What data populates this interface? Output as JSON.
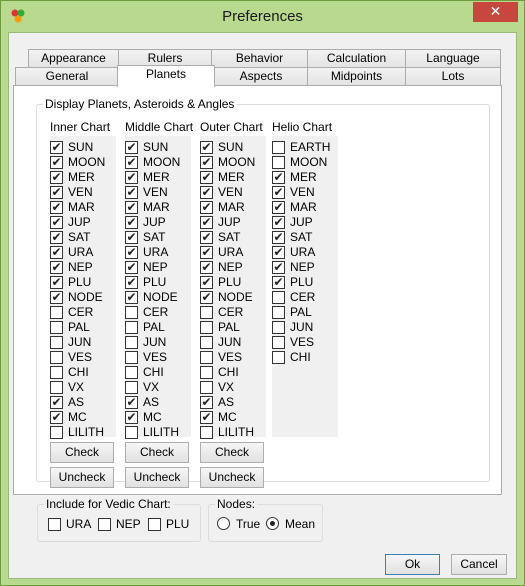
{
  "window": {
    "title": "Preferences",
    "close": "✕"
  },
  "tabs_row1": [
    "Appearance",
    "Rulers",
    "Behavior",
    "Calculation",
    "Language"
  ],
  "tabs_row2": [
    "General",
    "Planets",
    "Aspects",
    "Midpoints",
    "Lots"
  ],
  "active_tab": "Planets",
  "display_group_label": "Display Planets, Asteroids & Angles",
  "columns": [
    {
      "header": "Inner Chart",
      "items": [
        {
          "label": "SUN",
          "checked": true
        },
        {
          "label": "MOON",
          "checked": true
        },
        {
          "label": "MER",
          "checked": true
        },
        {
          "label": "VEN",
          "checked": true
        },
        {
          "label": "MAR",
          "checked": true
        },
        {
          "label": "JUP",
          "checked": true
        },
        {
          "label": "SAT",
          "checked": true
        },
        {
          "label": "URA",
          "checked": true
        },
        {
          "label": "NEP",
          "checked": true
        },
        {
          "label": "PLU",
          "checked": true
        },
        {
          "label": "NODE",
          "checked": true
        },
        {
          "label": "CER",
          "checked": false
        },
        {
          "label": "PAL",
          "checked": false
        },
        {
          "label": "JUN",
          "checked": false
        },
        {
          "label": "VES",
          "checked": false
        },
        {
          "label": "CHI",
          "checked": false
        },
        {
          "label": "VX",
          "checked": false
        },
        {
          "label": "AS",
          "checked": true
        },
        {
          "label": "MC",
          "checked": true
        },
        {
          "label": "LILITH",
          "checked": false
        }
      ]
    },
    {
      "header": "Middle Chart",
      "items": [
        {
          "label": "SUN",
          "checked": true
        },
        {
          "label": "MOON",
          "checked": true
        },
        {
          "label": "MER",
          "checked": true
        },
        {
          "label": "VEN",
          "checked": true
        },
        {
          "label": "MAR",
          "checked": true
        },
        {
          "label": "JUP",
          "checked": true
        },
        {
          "label": "SAT",
          "checked": true
        },
        {
          "label": "URA",
          "checked": true
        },
        {
          "label": "NEP",
          "checked": true
        },
        {
          "label": "PLU",
          "checked": true
        },
        {
          "label": "NODE",
          "checked": true
        },
        {
          "label": "CER",
          "checked": false
        },
        {
          "label": "PAL",
          "checked": false
        },
        {
          "label": "JUN",
          "checked": false
        },
        {
          "label": "VES",
          "checked": false
        },
        {
          "label": "CHI",
          "checked": false
        },
        {
          "label": "VX",
          "checked": false
        },
        {
          "label": "AS",
          "checked": true
        },
        {
          "label": "MC",
          "checked": true
        },
        {
          "label": "LILITH",
          "checked": false
        }
      ]
    },
    {
      "header": "Outer Chart",
      "items": [
        {
          "label": "SUN",
          "checked": true
        },
        {
          "label": "MOON",
          "checked": true
        },
        {
          "label": "MER",
          "checked": true
        },
        {
          "label": "VEN",
          "checked": true
        },
        {
          "label": "MAR",
          "checked": true
        },
        {
          "label": "JUP",
          "checked": true
        },
        {
          "label": "SAT",
          "checked": true
        },
        {
          "label": "URA",
          "checked": true
        },
        {
          "label": "NEP",
          "checked": true
        },
        {
          "label": "PLU",
          "checked": true
        },
        {
          "label": "NODE",
          "checked": true
        },
        {
          "label": "CER",
          "checked": false
        },
        {
          "label": "PAL",
          "checked": false
        },
        {
          "label": "JUN",
          "checked": false
        },
        {
          "label": "VES",
          "checked": false
        },
        {
          "label": "CHI",
          "checked": false
        },
        {
          "label": "VX",
          "checked": false
        },
        {
          "label": "AS",
          "checked": true
        },
        {
          "label": "MC",
          "checked": true
        },
        {
          "label": "LILITH",
          "checked": false
        }
      ]
    },
    {
      "header": "Helio Chart",
      "items": [
        {
          "label": "EARTH",
          "checked": false
        },
        {
          "label": "MOON",
          "checked": false
        },
        {
          "label": "MER",
          "checked": true
        },
        {
          "label": "VEN",
          "checked": true
        },
        {
          "label": "MAR",
          "checked": true
        },
        {
          "label": "JUP",
          "checked": true
        },
        {
          "label": "SAT",
          "checked": true
        },
        {
          "label": "URA",
          "checked": true
        },
        {
          "label": "NEP",
          "checked": true
        },
        {
          "label": "PLU",
          "checked": true
        },
        {
          "label": "CER",
          "checked": false
        },
        {
          "label": "PAL",
          "checked": false
        },
        {
          "label": "JUN",
          "checked": false
        },
        {
          "label": "VES",
          "checked": false
        },
        {
          "label": "CHI",
          "checked": false
        }
      ]
    }
  ],
  "check_label": "Check",
  "uncheck_label": "Uncheck",
  "vedic": {
    "label": "Include for Vedic Chart:",
    "items": [
      {
        "label": "URA",
        "checked": false
      },
      {
        "label": "NEP",
        "checked": false
      },
      {
        "label": "PLU",
        "checked": false
      }
    ]
  },
  "nodes": {
    "label": "Nodes:",
    "options": [
      {
        "label": "True",
        "selected": false
      },
      {
        "label": "Mean",
        "selected": true
      }
    ]
  },
  "ok_label": "Ok",
  "cancel_label": "Cancel",
  "check_mark": "✔"
}
